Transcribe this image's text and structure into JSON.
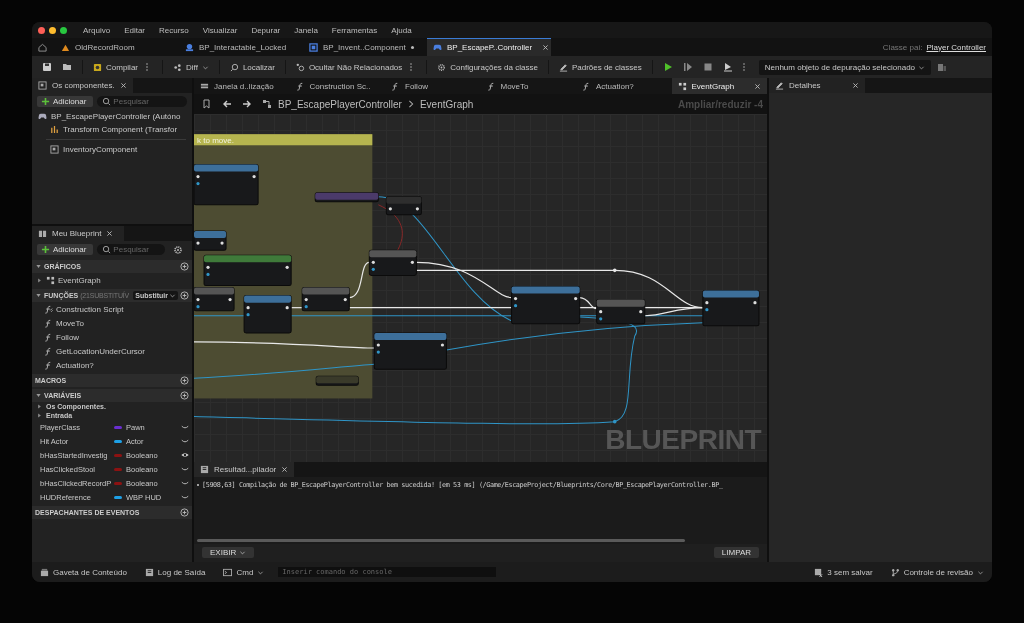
{
  "menu": [
    "Arquivo",
    "Editar",
    "Recurso",
    "Visualizar",
    "Depurar",
    "Janela",
    "Ferramentas",
    "Ajuda"
  ],
  "document_tabs": [
    {
      "label": "OldRecordRoom",
      "kind": "level",
      "selected": false,
      "modified": false
    },
    {
      "label": "BP_Interactable_Locked",
      "kind": "blueprint",
      "selected": false,
      "modified": false
    },
    {
      "label": "BP_Invent..Component",
      "kind": "component",
      "selected": false,
      "modified": true
    },
    {
      "label": "BP_EscapeP..Controller",
      "kind": "controller",
      "selected": true,
      "modified": true
    }
  ],
  "parent_class": {
    "label": "Classe pai:",
    "value": "Player Controller"
  },
  "toolbar": {
    "buttons": [
      {
        "label": "Compilar",
        "kind": "compile",
        "more": true,
        "dropdown": false
      },
      {
        "label": "Diff",
        "kind": "diff",
        "more": false,
        "dropdown": true
      },
      {
        "label": "Localizar",
        "kind": "find",
        "more": false,
        "dropdown": false
      },
      {
        "label": "Ocultar Não Relacionados",
        "kind": "hide",
        "more": true,
        "dropdown": false
      },
      {
        "label": "Configurações da classe",
        "kind": "settings",
        "more": false,
        "dropdown": false
      },
      {
        "label": "Padrões de classes",
        "kind": "defaults",
        "more": false,
        "dropdown": false
      }
    ],
    "debug_filter": "Nenhum objeto de depuração selecionado"
  },
  "components_panel": {
    "title": "Os componentes.",
    "add": "Adicionar",
    "search_placeholder": "Pesquisar",
    "tree": [
      {
        "label": "BP_EscapePlayerController (Autóno",
        "children": [
          {
            "label": "Transform Component (Transfor"
          }
        ]
      }
    ],
    "components": [
      {
        "label": "InventoryComponent"
      }
    ]
  },
  "my_blueprint": {
    "title": "Meu Blueprint",
    "add": "Adicionar",
    "search_placeholder": "Pesquisar",
    "sections": [
      {
        "kind": "graphs",
        "title": "GRÁFICOS",
        "expanded": true,
        "items": [
          {
            "label": "EventGraph",
            "expanded": false
          }
        ]
      },
      {
        "kind": "functions",
        "title": "FUNÇÕES",
        "hint": "(21SUBSTITUÍV",
        "override": "Substituir",
        "expanded": true,
        "items": [
          {
            "label": "Construction Script",
            "kind": "construction"
          },
          {
            "label": "MoveTo",
            "kind": "function"
          },
          {
            "label": "Follow",
            "kind": "function"
          },
          {
            "label": "GetLocationUnderCursor",
            "kind": "function"
          },
          {
            "label": "Actuation?",
            "kind": "function"
          }
        ]
      },
      {
        "kind": "macros",
        "title": "MACROS",
        "expanded": false
      },
      {
        "kind": "variables",
        "title": "VARIÁVEIS",
        "expanded": true,
        "categories": [
          {
            "label": "Os Componentes.",
            "expanded": false
          },
          {
            "label": "Entrada",
            "expanded": false
          }
        ],
        "variables": [
          {
            "name": "PlayerClass",
            "type": "Pawn",
            "color": "#6a2fd0",
            "visible": false
          },
          {
            "name": "Hit Actor",
            "type": "Actor",
            "color": "#1ea0e6",
            "visible": false
          },
          {
            "name": "bHasStartedInvestig",
            "type": "Booleano",
            "color": "#8c1212",
            "visible": true
          },
          {
            "name": "HasClickedStool",
            "type": "Booleano",
            "color": "#8c1212",
            "visible": false
          },
          {
            "name": "bHasClickedRecordP",
            "type": "Booleano",
            "color": "#8c1212",
            "visible": false
          },
          {
            "name": "HUDReference",
            "type": "WBP HUD",
            "color": "#1ea0e6",
            "visible": false
          }
        ]
      },
      {
        "kind": "dispatchers",
        "title": "DESPACHANTES DE EVENTOS",
        "expanded": false
      }
    ]
  },
  "graph_tabs": [
    {
      "label": "Janela d..lização",
      "kind": "viewport",
      "selected": false
    },
    {
      "label": "Construction Sc..",
      "kind": "function",
      "selected": false
    },
    {
      "label": "Follow",
      "kind": "function",
      "selected": false
    },
    {
      "label": "MoveTo",
      "kind": "function",
      "selected": false
    },
    {
      "label": "Actuation?",
      "kind": "function",
      "selected": false
    },
    {
      "label": "EventGraph",
      "kind": "graph",
      "selected": true
    }
  ],
  "graph": {
    "breadcrumb": [
      "BP_EscapePlayerController",
      "EventGraph"
    ],
    "zoom": "Ampliar/reduzir -4",
    "comment": "k to move.",
    "watermark": "BLUEPRINT"
  },
  "output": {
    "title": "Resultad...pilador",
    "messages": [
      "[5908,63] Compilação de BP_EscapePlayerController bem sucedida! [em 53 ms] (/Game/EscapeProject/Blueprints/Core/BP_EscapePlayerController.BP_"
    ],
    "show": "EXIBIR",
    "clear": "LIMPAR"
  },
  "details_panel": {
    "title": "Detalhes"
  },
  "status_bar": {
    "content_drawer": "Gaveta de Conteúdo",
    "output_log": "Log de Saída",
    "cmd": "Cmd",
    "console_placeholder": "Inserir comando do console",
    "unsaved": "3 sem salvar",
    "source_control": "Controle de revisão"
  }
}
